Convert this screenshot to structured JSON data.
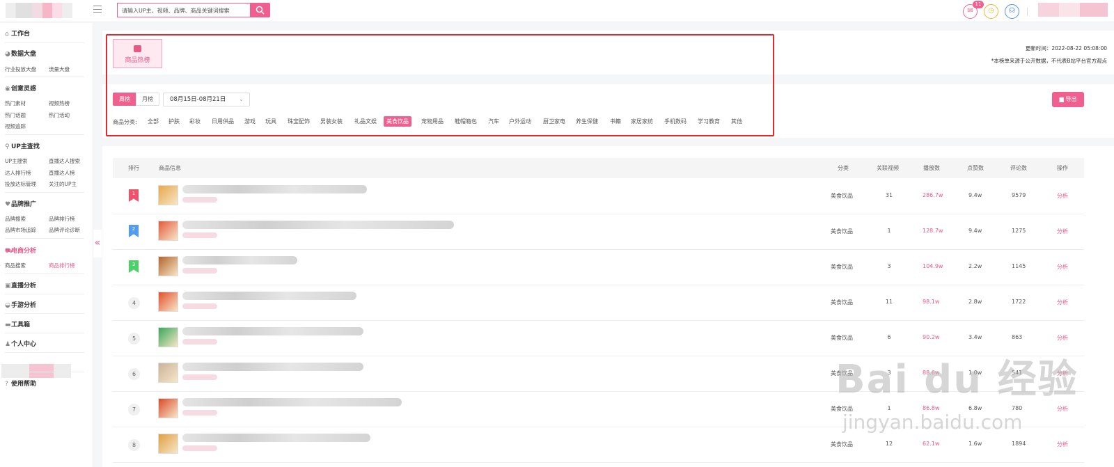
{
  "header": {
    "search_placeholder": "请输入UP主、视频、品牌、商品关键词搜索",
    "message_count": "11"
  },
  "sidebar": {
    "workbench": "工作台",
    "sections": [
      {
        "title": "数据大盘",
        "items": [
          "行业投放大盘",
          "流量大盘"
        ]
      },
      {
        "title": "创意灵感",
        "items": [
          "热门素材",
          "视频热榜",
          "热门话题",
          "热门活动",
          "视频追踪"
        ]
      },
      {
        "title": "UP主查找",
        "items": [
          "UP主搜索",
          "直播达人搜索",
          "达人排行榜",
          "直播达人榜",
          "投放达标管理",
          "关注的UP主"
        ]
      },
      {
        "title": "品牌推广",
        "items": [
          "品牌搜索",
          "品牌排行榜",
          "品牌市场追踪",
          "品牌评论诊断"
        ]
      },
      {
        "title": "电商分析",
        "items": [
          "商品搜索",
          "商品排行榜"
        ]
      },
      {
        "title": "直播分析",
        "items": []
      },
      {
        "title": "手游分析",
        "items": []
      },
      {
        "title": "工具箱",
        "items": []
      },
      {
        "title": "个人中心",
        "items": []
      }
    ],
    "help": "使用帮助",
    "collapse": "«"
  },
  "panel": {
    "tab_label": "商品热榜",
    "update_time": "更新时间：2022-08-22 05:08:00",
    "disclaimer": "*本榜单来源于公开数据，不代表B站平台官方观点",
    "week_label": "周榜",
    "month_label": "月榜",
    "date_range": "08月15日-08月21日",
    "export_label": "导出",
    "category_label": "商品分类:",
    "categories": [
      "全部",
      "护肤",
      "彩妆",
      "日用供品",
      "游戏",
      "玩具",
      "珠宝配饰",
      "男装女装",
      "礼品文娱",
      "美食饮品",
      "宠物用品",
      "鞋帽箱包",
      "汽车",
      "户外运动",
      "厨卫家电",
      "养生保健",
      "书籍",
      "家居家纺",
      "手机数码",
      "学习教育",
      "其他"
    ],
    "active_category": "美食饮品"
  },
  "table": {
    "headers": [
      "排行",
      "商品信息",
      "分类",
      "关联视频",
      "播放数",
      "点赞数",
      "评论数",
      "操作"
    ],
    "rows": [
      {
        "rank": "1",
        "category": "美食饮品",
        "videos": "31",
        "plays": "286.7w",
        "likes": "9.4w",
        "comments": "9579",
        "action": "分析"
      },
      {
        "rank": "2",
        "category": "美食饮品",
        "videos": "1",
        "plays": "128.7w",
        "likes": "9.4w",
        "comments": "1275",
        "action": "分析"
      },
      {
        "rank": "3",
        "category": "美食饮品",
        "videos": "3",
        "plays": "104.9w",
        "likes": "2.2w",
        "comments": "1145",
        "action": "分析"
      },
      {
        "rank": "4",
        "category": "美食饮品",
        "videos": "11",
        "plays": "98.1w",
        "likes": "2.8w",
        "comments": "1722",
        "action": "分析"
      },
      {
        "rank": "5",
        "category": "美食饮品",
        "videos": "6",
        "plays": "90.2w",
        "likes": "3.4w",
        "comments": "863",
        "action": "分析"
      },
      {
        "rank": "6",
        "category": "美食饮品",
        "videos": "3",
        "plays": "88.6w",
        "likes": "1.0w",
        "comments": "541",
        "action": "分析"
      },
      {
        "rank": "7",
        "category": "美食饮品",
        "videos": "1",
        "plays": "86.8w",
        "likes": "6.8w",
        "comments": "780",
        "action": "分析"
      },
      {
        "rank": "8",
        "category": "美食饮品",
        "videos": "12",
        "plays": "62.1w",
        "likes": "1.6w",
        "comments": "1894",
        "action": "分析"
      }
    ]
  },
  "watermark": {
    "brand": "Bai du 经验",
    "url": "jingyan.baidu.com"
  },
  "colors": {
    "accent": "#f0608e",
    "rank1": "#f0506a",
    "rank2": "#4e9cf5",
    "rank3": "#4cd06b"
  }
}
